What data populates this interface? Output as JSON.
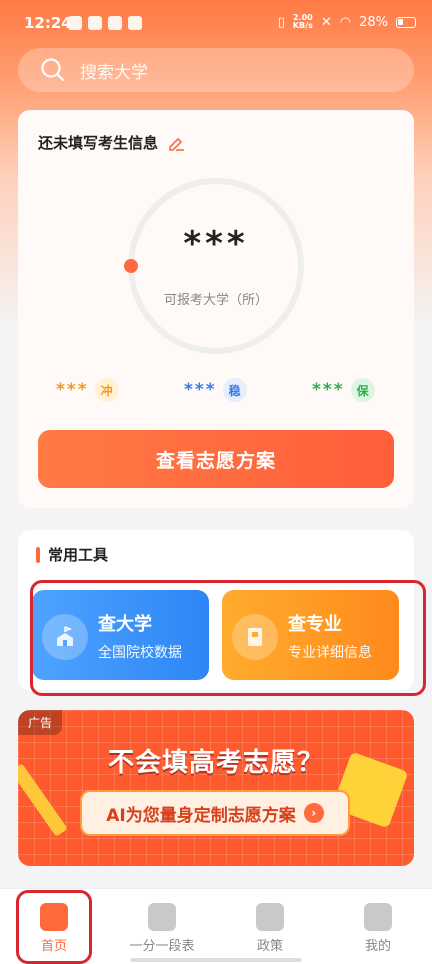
{
  "status_bar": {
    "time": "12:24",
    "net_speed_value": "2.00",
    "net_speed_unit": "KB/s",
    "battery": "28%"
  },
  "search": {
    "placeholder": "搜索大学"
  },
  "profile_card": {
    "title": "还未填写考生信息",
    "count": "***",
    "count_caption": "可报考大学（所）",
    "levels": [
      {
        "stars": "***",
        "tag": "冲",
        "color": "#f39a1e",
        "bg": "#fff0d6"
      },
      {
        "stars": "***",
        "tag": "稳",
        "color": "#3a7be8",
        "bg": "#e4eeff"
      },
      {
        "stars": "***",
        "tag": "保",
        "color": "#2fae4a",
        "bg": "#dff5e4"
      }
    ],
    "plan_button": "查看志愿方案"
  },
  "tools": {
    "section_title": "常用工具",
    "items": [
      {
        "title": "查大学",
        "subtitle": "全国院校数据",
        "icon": "school-icon",
        "color_from": "#4fa3ff",
        "color_to": "#2c86f5"
      },
      {
        "title": "查专业",
        "subtitle": "专业详细信息",
        "icon": "book-icon",
        "color_from": "#ffac2e",
        "color_to": "#ff8a1c"
      }
    ]
  },
  "ad": {
    "label": "广告",
    "headline": "不会填高考志愿？",
    "cta": "AI为您量身定制志愿方案"
  },
  "nav": {
    "items": [
      {
        "label": "首页",
        "icon": "home-icon",
        "active": true
      },
      {
        "label": "一分一段表",
        "icon": "clipboard-icon",
        "active": false
      },
      {
        "label": "政策",
        "icon": "badge-icon",
        "active": false
      },
      {
        "label": "我的",
        "icon": "user-icon",
        "active": false
      }
    ]
  },
  "colors": {
    "accent": "#ff6a3d",
    "highlight_box": "#d8262e"
  }
}
